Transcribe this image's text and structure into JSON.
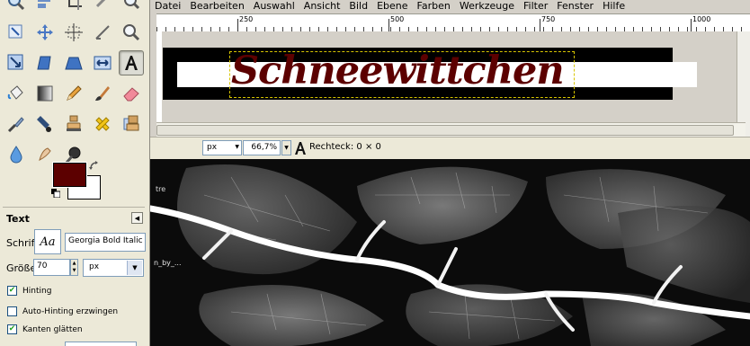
{
  "menu": [
    "Datei",
    "Bearbeiten",
    "Auswahl",
    "Ansicht",
    "Bild",
    "Ebene",
    "Farben",
    "Werkzeuge",
    "Filter",
    "Fenster",
    "Hilfe"
  ],
  "ruler": {
    "major_labels": [
      "250",
      "500",
      "750",
      "1000"
    ]
  },
  "canvas": {
    "text_content": "Schneewittchen",
    "text_color": "#5c0000"
  },
  "statusbar": {
    "unit": "px",
    "zoom": "66,7%",
    "message": "Rechteck: 0 × 0"
  },
  "colors": {
    "foreground": "#5c0000",
    "background": "#ffffff"
  },
  "tool_options": {
    "title": "Text",
    "menu_arrow": "◀",
    "font_label": "Schrift:",
    "font_preview": "Aa",
    "font_value": "Georgia Bold Italic",
    "size_label": "Größe:",
    "size_value": "70",
    "size_unit": "px",
    "hinting_label": "Hinting",
    "hinting_checked": true,
    "autohint_label": "Auto-Hinting erzwingen",
    "autohint_checked": false,
    "antialias_label": "Kanten glätten",
    "antialias_checked": true
  },
  "background_image": {
    "title_fragment": "tre",
    "file_fragment": "n_by_..."
  },
  "tools": [
    "zoom-tool-icon",
    "align-tool-icon",
    "crop-tool-icon",
    "rotate-tool-icon",
    "magnifier-icon",
    "scale-tool-icon",
    "shear-tool-icon",
    "perspective-tool-icon",
    "flip-tool-icon",
    "text-tool-icon",
    "bucket-fill-icon",
    "blend-tool-icon",
    "pencil-icon",
    "paintbrush-icon",
    "eraser-icon",
    "airbrush-icon",
    "ink-tool-icon",
    "clone-tool-icon",
    "heal-tool-icon",
    "perspective-clone-icon",
    "blur-tool-icon",
    "smudge-tool-icon",
    "dodge-burn-icon"
  ]
}
